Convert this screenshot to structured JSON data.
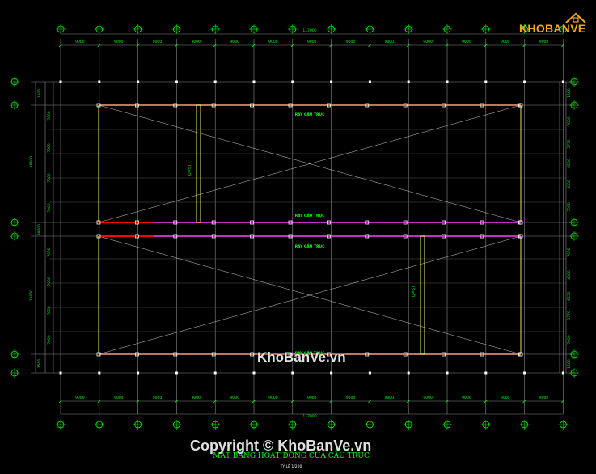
{
  "drawing": {
    "title": "MẶT BẰNG HOẠT ĐỘNG CỦA CẦU TRỤC",
    "scale_note": "TỶ LỆ 1/200",
    "overall_dimension_top": "117000",
    "overall_dimension_bottom": "117000",
    "bay_dimensions": [
      "9000",
      "9000",
      "9000",
      "9000",
      "9000",
      "9000",
      "9000",
      "9000",
      "9000",
      "9000",
      "9000",
      "9000",
      "9000"
    ],
    "left_side_dims_outer": [
      "1500",
      "38000",
      "1500"
    ],
    "left_side_dims_inner": [
      "7000",
      "7000",
      "7000",
      "7000",
      "7000",
      "7000",
      "7000",
      "7000"
    ],
    "left_mid_total": "18000",
    "right_side_dims": [
      "1500",
      "7000",
      "3770",
      "6530",
      "4000",
      "7000",
      "7000",
      "4000",
      "6530",
      "3770",
      "7000",
      "1500"
    ],
    "crane_label": "Q=5T",
    "rail_label": "RAY CẦU TRỤC",
    "colors": {
      "background": "#000000",
      "grid": "#8a8a8a",
      "text_green": "#00ff00",
      "column": "#ffffff",
      "rail_top": "#ff9c7a",
      "rail_mid": "#ff40ff",
      "crane_beam": "#ffff66",
      "red_segment": "#ff0000",
      "axis_bubble": "#00ff00"
    }
  },
  "watermarks": {
    "center": "KhoBanVe.vn",
    "copyright": "Copyright © KhoBanVe.vn",
    "logo": "KHOBANVE"
  }
}
